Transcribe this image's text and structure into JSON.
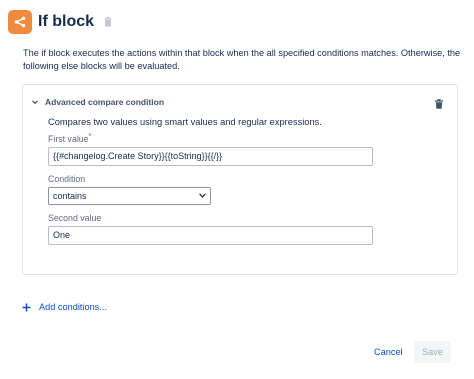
{
  "header": {
    "title": "If block",
    "icon": "branch-icon",
    "accent_color": "#f08a3e"
  },
  "description": "The if block executes the actions within that block when the all specified conditions matches. Otherwise, the following else blocks will be evaluated.",
  "condition_card": {
    "title": "Advanced compare condition",
    "summary": "Compares two values using smart values and regular expressions.",
    "first_value": {
      "label": "First value",
      "required_marker": "*",
      "value": "{{#changelog.Create Story}}{{toString}}{{/}}"
    },
    "condition": {
      "label": "Condition",
      "selected": "contains"
    },
    "second_value": {
      "label": "Second value",
      "value": "One"
    }
  },
  "add_conditions_label": "Add conditions...",
  "footer": {
    "cancel_label": "Cancel",
    "save_label": "Save"
  }
}
